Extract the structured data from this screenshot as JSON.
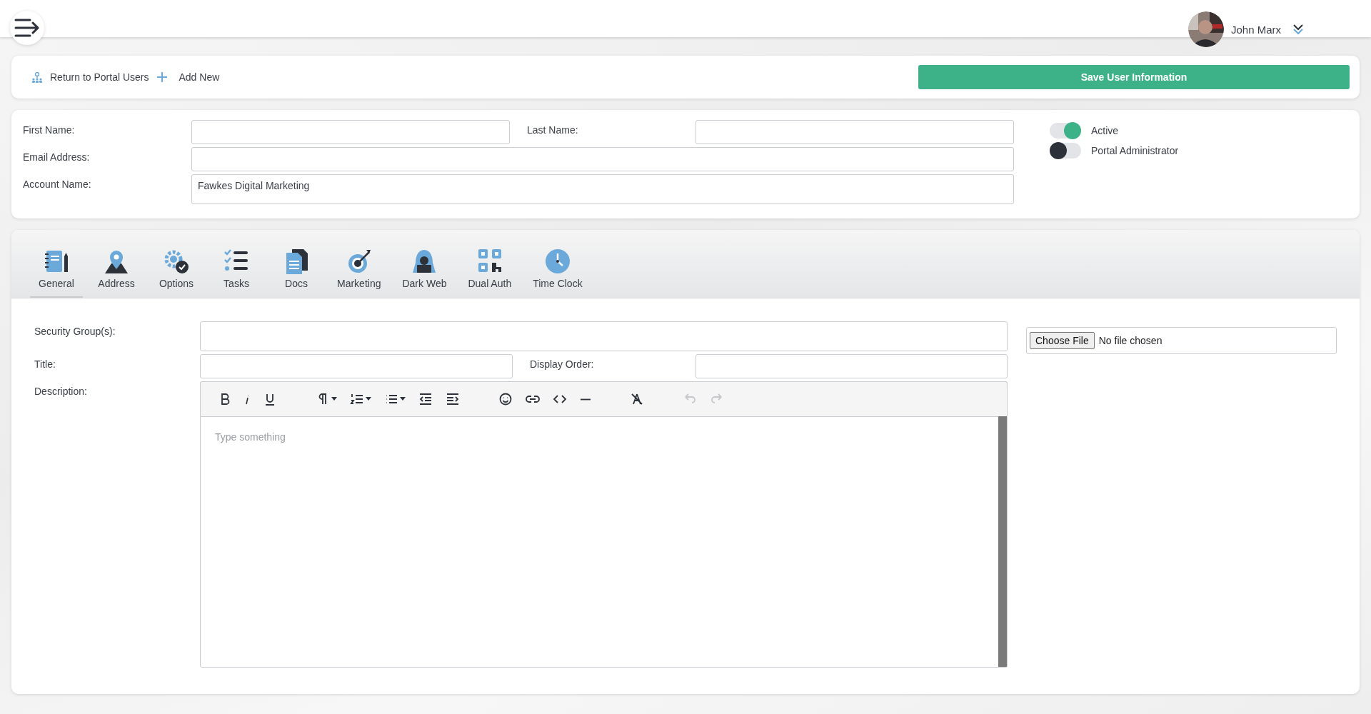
{
  "user": {
    "name": "John Marx"
  },
  "actions": {
    "return_link": "Return to Portal Users",
    "add_link": "Add New",
    "save_button": "Save User Information"
  },
  "user_form": {
    "first_name": {
      "label": "First Name:"
    },
    "last_name": {
      "label": "Last Name:"
    },
    "email": {
      "label": "Email Address:"
    },
    "account_name": {
      "label": "Account Name:",
      "value": "Fawkes Digital Marketing"
    },
    "toggles": [
      {
        "label": "Active",
        "on": true
      },
      {
        "label": "Portal Administrator",
        "on": false
      }
    ]
  },
  "tabs": [
    {
      "label": "General",
      "selected": true
    },
    {
      "label": "Address",
      "selected": false
    },
    {
      "label": "Options",
      "selected": false
    },
    {
      "label": "Tasks",
      "selected": false
    },
    {
      "label": "Docs",
      "selected": false
    },
    {
      "label": "Marketing",
      "selected": false
    },
    {
      "label": "Dark Web",
      "selected": false
    },
    {
      "label": "Dual Auth",
      "selected": false
    },
    {
      "label": "Time Clock",
      "selected": false
    }
  ],
  "general": {
    "security_groups": {
      "label": "Security Group(s):"
    },
    "title": {
      "label": "Title:"
    },
    "display_order": {
      "label": "Display Order:"
    },
    "description": {
      "label": "Description:",
      "placeholder": "Type something"
    },
    "file_upload": {
      "button": "Choose File",
      "status": "No file chosen"
    },
    "toolbar": [
      {
        "disabled": false
      },
      {
        "disabled": false
      },
      {
        "disabled": false
      },
      {
        "disabled": false
      },
      {
        "disabled": false
      },
      {
        "disabled": false
      },
      {
        "disabled": false
      },
      {
        "disabled": false
      },
      {
        "disabled": false
      },
      {
        "disabled": false
      },
      {
        "disabled": false
      },
      {
        "disabled": false
      },
      {
        "disabled": false
      },
      {
        "disabled": true
      },
      {
        "disabled": true
      }
    ]
  }
}
